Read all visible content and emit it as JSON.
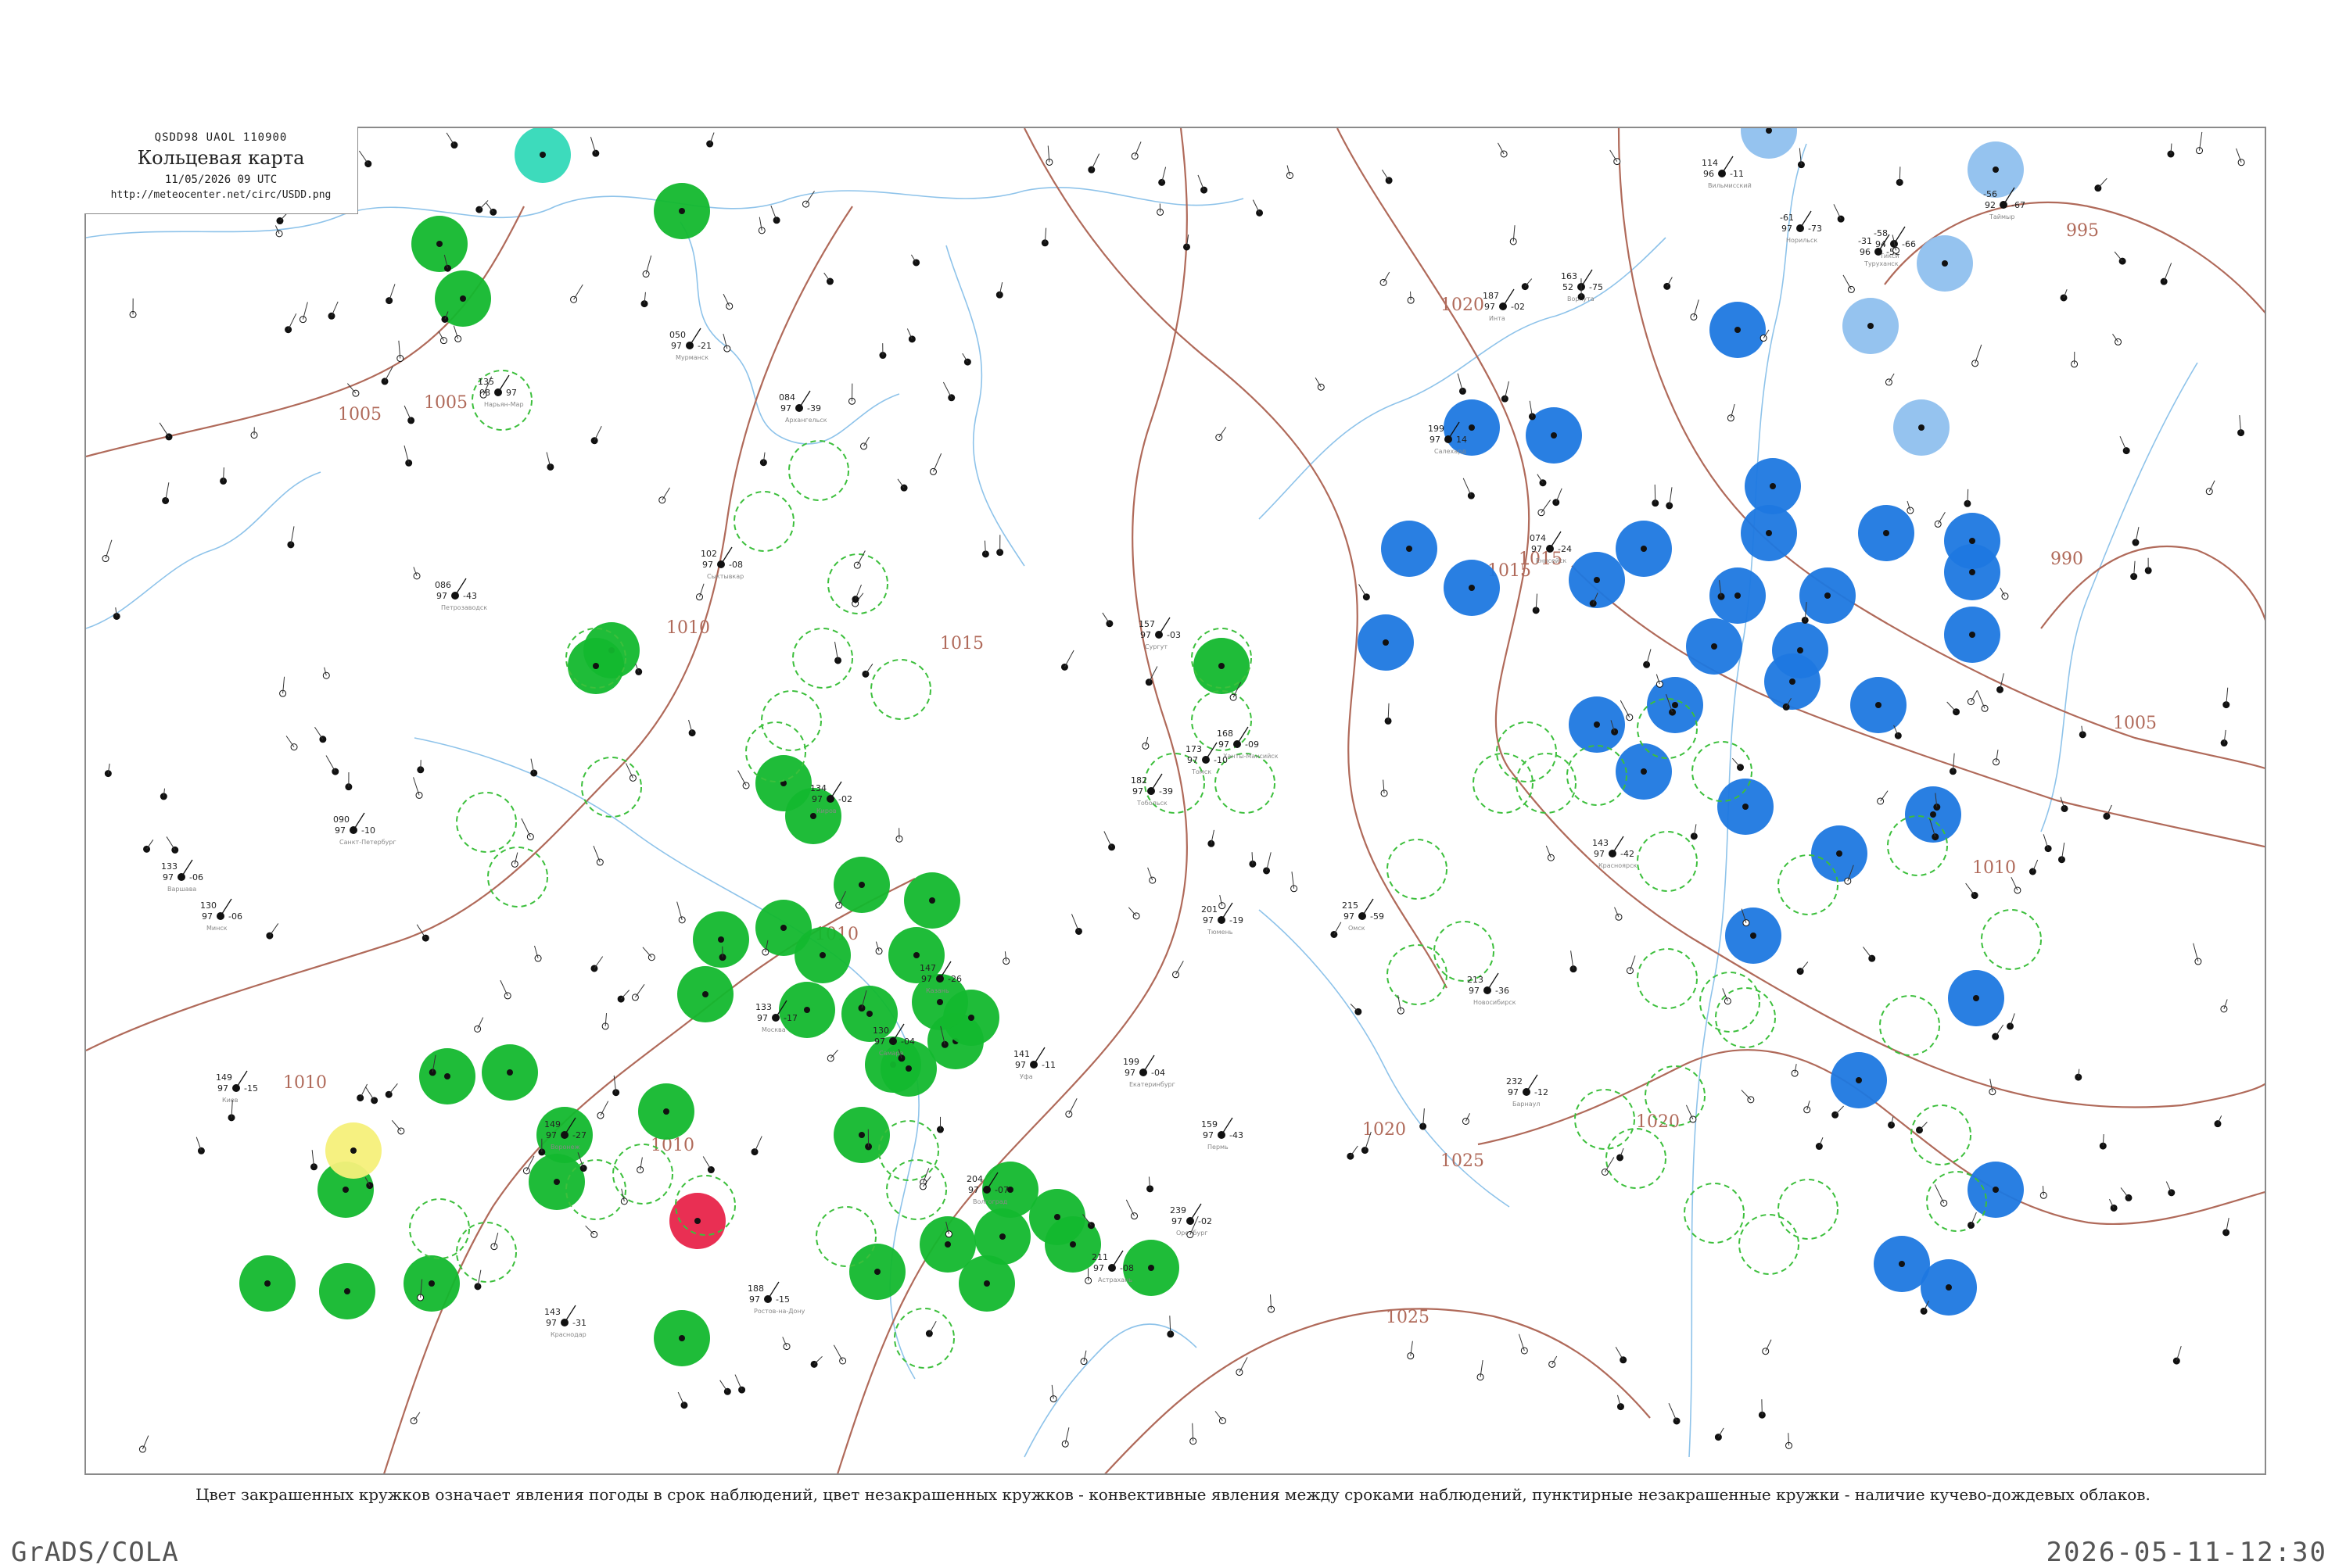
{
  "header": {
    "code": "QSDD98  UAOL  110900",
    "title": "Кольцевая карта",
    "date": "11/05/2026 09 UTC",
    "url": "http://meteocenter.net/circ/USDD.png"
  },
  "footer_note": "Цвет закрашенных кружков означает явления погоды в срок наблюдений, цвет незакрашенных кружков - конвективные явления между сроками наблюдений, пунктирные незакрашенные кружки - наличие кучево-дождевых облаков.",
  "software_label": "GrADS/COLA",
  "timestamp": "2026-05-11-12:30",
  "colors": {
    "isobar": "#b06a5a",
    "river": "#8ec3ea",
    "green_marker": "#13b82e",
    "blue_marker": "#1e78e0",
    "light_blue_marker": "#8fc0ee",
    "cyan_marker": "#33d9b8",
    "yellow_marker": "#f5f07a",
    "red_marker": "#e8244a",
    "dashed_ring": "#3cbf3c"
  },
  "isobar_labels": [
    "1005",
    "1005",
    "1010",
    "1010",
    "1010",
    "1010",
    "1015",
    "1015",
    "1015",
    "1020",
    "1020",
    "1020",
    "1025",
    "1025",
    "995",
    "990",
    "1005",
    "1010",
    "10"
  ],
  "stations": [
    {
      "name": "Вильмисский",
      "t": "114",
      "td": "-11",
      "p": "96"
    },
    {
      "name": "Нарьян-Мар",
      "t": "135",
      "td": "97",
      "p": "08"
    },
    {
      "name": "Инта",
      "t": "187",
      "td": "-02",
      "p": "97"
    },
    {
      "name": "Воркута",
      "t": "163",
      "td": "-75",
      "p": "52"
    },
    {
      "name": "Салехард",
      "t": "199",
      "td": "14",
      "p": "97"
    },
    {
      "name": "Сургут",
      "t": "157",
      "td": "-03",
      "p": "97"
    },
    {
      "name": "Ханты-Мансийск",
      "t": "168",
      "td": "-09",
      "p": "97"
    },
    {
      "name": "Тобольск",
      "t": "182",
      "td": "-39",
      "p": "97"
    },
    {
      "name": "Тюмень",
      "t": "201",
      "td": "-19",
      "p": "97"
    },
    {
      "name": "Омск",
      "t": "215",
      "td": "-59",
      "p": "97"
    },
    {
      "name": "Новосибирск",
      "t": "213",
      "td": "-36",
      "p": "97"
    },
    {
      "name": "Барнаул",
      "t": "232",
      "td": "-12",
      "p": "97"
    },
    {
      "name": "Томск",
      "t": "173",
      "td": "-10",
      "p": "97"
    },
    {
      "name": "Красноярск",
      "t": "143",
      "td": "-42",
      "p": "97"
    },
    {
      "name": "Екатеринбург",
      "t": "199",
      "td": "-04",
      "p": "97"
    },
    {
      "name": "Пермь",
      "t": "159",
      "td": "-43",
      "p": "97"
    },
    {
      "name": "Уфа",
      "t": "141",
      "td": "-11",
      "p": "97"
    },
    {
      "name": "Оренбург",
      "t": "239",
      "td": "-02",
      "p": "97"
    },
    {
      "name": "Самара",
      "t": "130",
      "td": "-04",
      "p": "97"
    },
    {
      "name": "Казань",
      "t": "147",
      "td": "-26",
      "p": "97"
    },
    {
      "name": "Киров",
      "t": "134",
      "td": "-02",
      "p": "97"
    },
    {
      "name": "Сыктывкар",
      "t": "102",
      "td": "-08",
      "p": "97"
    },
    {
      "name": "Архангельск",
      "t": "084",
      "td": "-39",
      "p": "97"
    },
    {
      "name": "Мурманск",
      "t": "050",
      "td": "-21",
      "p": "97"
    },
    {
      "name": "Петрозаводск",
      "t": "086",
      "td": "-43",
      "p": "97"
    },
    {
      "name": "Санкт-Петербург",
      "t": "090",
      "td": "-10",
      "p": "97"
    },
    {
      "name": "Москва",
      "t": "133",
      "td": "-17",
      "p": "97"
    },
    {
      "name": "Воронеж",
      "t": "149",
      "td": "-27",
      "p": "97"
    },
    {
      "name": "Волгоград",
      "t": "204",
      "td": "-07",
      "p": "97"
    },
    {
      "name": "Астрахань",
      "t": "211",
      "td": "-08",
      "p": "97"
    },
    {
      "name": "Ростов-на-Дону",
      "t": "188",
      "td": "-15",
      "p": "97"
    },
    {
      "name": "Краснодар",
      "t": "143",
      "td": "-31",
      "p": "97"
    },
    {
      "name": "Минск",
      "t": "130",
      "td": "-06",
      "p": "97"
    },
    {
      "name": "Киев",
      "t": "149",
      "td": "-15",
      "p": "97"
    },
    {
      "name": "Варшава",
      "t": "133",
      "td": "-06",
      "p": "97"
    },
    {
      "name": "Таймыр",
      "t": "-56",
      "td": "-67",
      "p": "92"
    },
    {
      "name": "Тикси",
      "t": "-58",
      "td": "-66",
      "p": "94"
    },
    {
      "name": "Норильск",
      "t": "-61",
      "td": "-73",
      "p": "97"
    },
    {
      "name": "Туруханск",
      "t": "-31",
      "td": "-52",
      "p": "96"
    },
    {
      "name": "Енисейск",
      "t": "074",
      "td": "-24",
      "p": "97"
    }
  ]
}
